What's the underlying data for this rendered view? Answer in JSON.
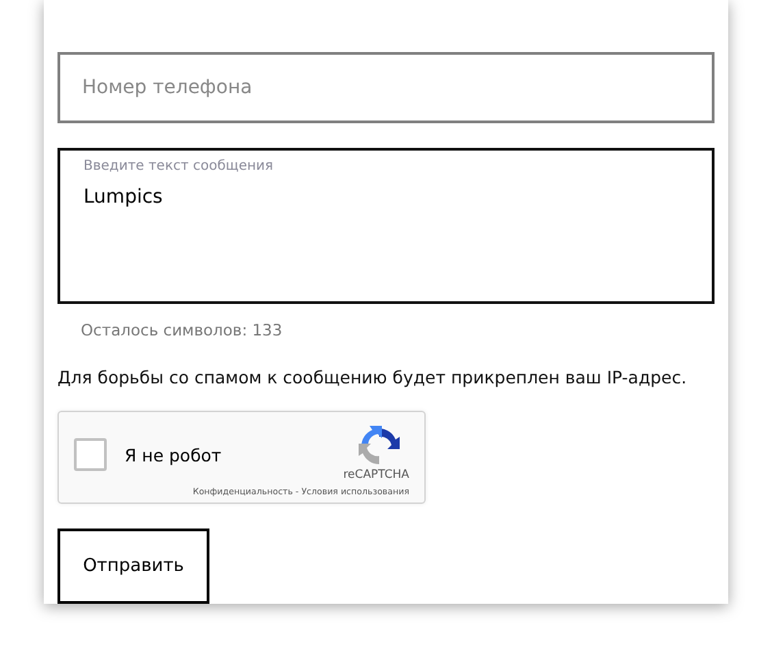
{
  "phone_field": {
    "placeholder": "Номер телефона"
  },
  "message_field": {
    "label": "Введите текст сообщения",
    "value": "Lumpics"
  },
  "char_counter": "Осталось символов: 133",
  "notice": "Для борьбы со спамом к сообщению будет прикреплен ваш IP-адрес.",
  "captcha": {
    "label": "Я не робот",
    "checked": false,
    "brand": "reCAPTCHA",
    "privacy_link": "Конфиденциальность",
    "separator": " - ",
    "terms_link": "Условия использования"
  },
  "submit_button": "Отправить"
}
